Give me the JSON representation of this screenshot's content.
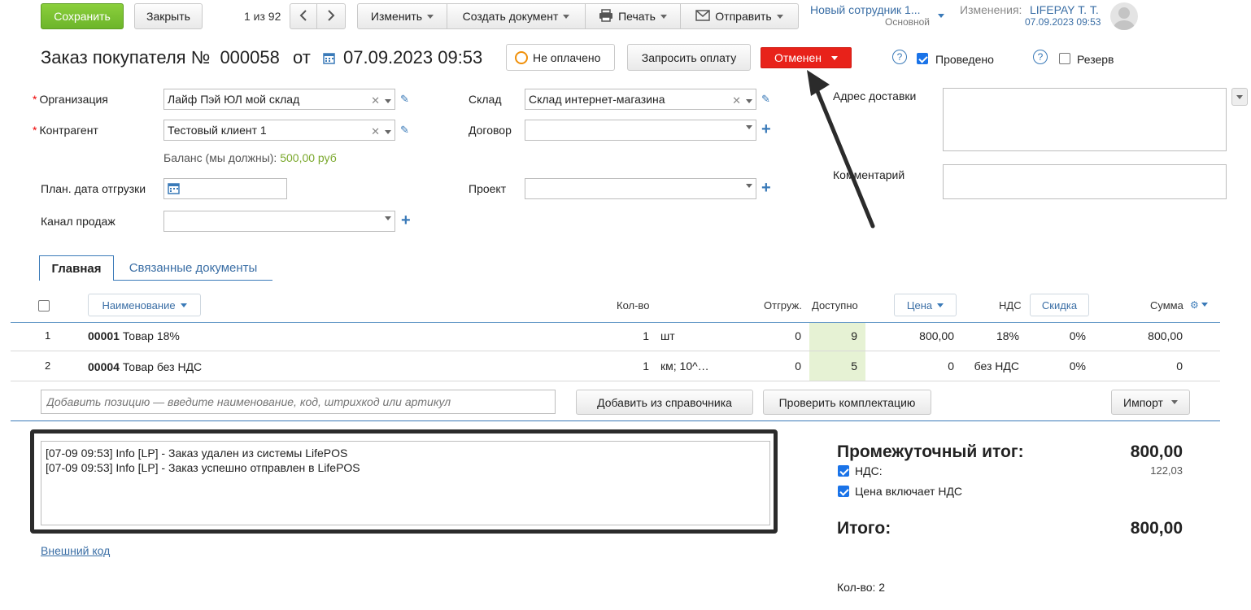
{
  "toolbar": {
    "save": "Сохранить",
    "close": "Закрыть",
    "pager": "1 из 92",
    "edit": "Изменить",
    "create_doc": "Создать документ",
    "print": "Печать",
    "send": "Отправить",
    "employee": "Новый сотрудник 1...",
    "employee_sub": "Основной",
    "changes_label": "Изменения:",
    "changes_user": "LIFEPAY Т. Т.",
    "changes_date": "07.09.2023 09:53"
  },
  "header": {
    "title": "Заказ покупателя №",
    "number": "000058",
    "from": "от",
    "date": "07.09.2023 09:53",
    "payment_status": "Не оплачено",
    "request_payment": "Запросить оплату",
    "state": "Отменен",
    "posted_label": "Проведено",
    "reserve_label": "Резерв",
    "help_symbol": "?"
  },
  "form": {
    "org_label": "Организация",
    "org_value": "Лайф Пэй ЮЛ мой склад",
    "contractor_label": "Контрагент",
    "contractor_value": "Тестовый клиент 1",
    "balance_label": "Баланс (мы должны):",
    "balance_value": "500,00 руб",
    "ship_date_label": "План. дата отгрузки",
    "channel_label": "Канал продаж",
    "warehouse_label": "Склад",
    "warehouse_value": "Склад интернет-магазина",
    "contract_label": "Договор",
    "project_label": "Проект",
    "address_label": "Адрес доставки",
    "comment_label": "Комментарий"
  },
  "tabs": [
    "Главная",
    "Связанные документы"
  ],
  "table": {
    "col_name": "Наименование",
    "col_qty": "Кол-во",
    "col_shipped": "Отгруж.",
    "col_available": "Доступно",
    "col_price": "Цена",
    "col_vat": "НДС",
    "col_discount": "Скидка",
    "col_sum": "Сумма",
    "rows": [
      {
        "n": "1",
        "code": "00001",
        "name": "Товар 18%",
        "qty": "1",
        "unit": "шт",
        "shipped": "0",
        "available": "9",
        "price": "800,00",
        "vat": "18%",
        "discount": "0%",
        "sum": "800,00"
      },
      {
        "n": "2",
        "code": "00004",
        "name": "Товар без НДС",
        "qty": "1",
        "unit": "км; 10^…",
        "shipped": "0",
        "available": "5",
        "price": "0",
        "vat": "без НДС",
        "discount": "0%",
        "sum": "0"
      }
    ]
  },
  "actions": {
    "add_placeholder": "Добавить позицию — введите наименование, код, штрихкод или артикул",
    "add_from_catalog": "Добавить из справочника",
    "check_kit": "Проверить комплектацию",
    "import": "Импорт"
  },
  "log": {
    "text": "[07-09 09:53] Info [LP] - Заказ удален из системы LifePOS\n[07-09 09:53] Info [LP] - Заказ успешно отправлен в LifePOS"
  },
  "external_code": "Внешний код",
  "totals": {
    "subtotal_label": "Промежуточный итог:",
    "subtotal": "800,00",
    "vat_label": "НДС:",
    "vat": "122,03",
    "price_incl_vat": "Цена включает НДС",
    "total_label": "Итого:",
    "total": "800,00",
    "count": "Кол-во: 2"
  },
  "colors": {
    "accent": "#3a7ab8",
    "save": "#7cc232",
    "cancel_state": "#e8221a",
    "available_bg": "#e6f2d4"
  }
}
